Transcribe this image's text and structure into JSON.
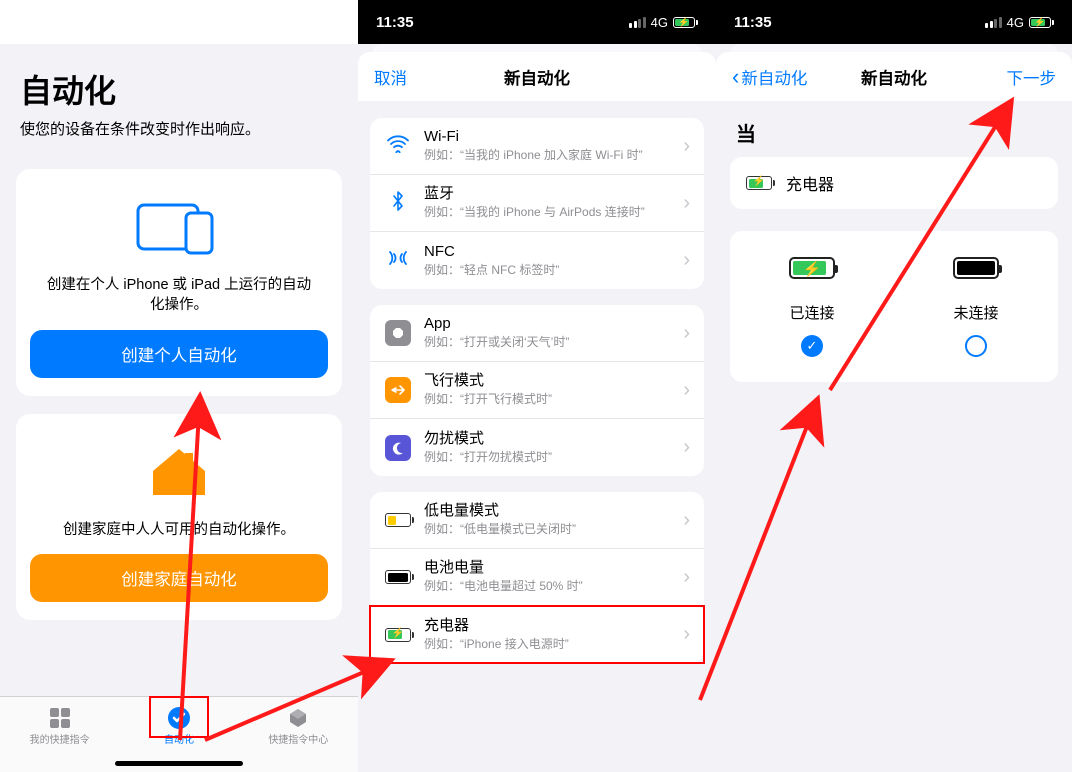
{
  "status": {
    "time": "11:35",
    "net": "4G"
  },
  "p1": {
    "title": "自动化",
    "subtitle": "使您的设备在条件改变时作出响应。",
    "card1_caption": "创建在个人 iPhone 或 iPad 上运行的自动化操作。",
    "card1_button": "创建个人自动化",
    "card2_caption": "创建家庭中人人可用的自动化操作。",
    "card2_button": "创建家庭自动化",
    "tabs": [
      "我的快捷指令",
      "自动化",
      "快捷指令中心"
    ]
  },
  "p2": {
    "cancel": "取消",
    "nav_title": "新自动化",
    "rows": [
      {
        "t1": "Wi-Fi",
        "t2": "例如：“当我的 iPhone 加入家庭 Wi-Fi 时”"
      },
      {
        "t1": "蓝牙",
        "t2": "例如：“当我的 iPhone 与 AirPods 连接时”"
      },
      {
        "t1": "NFC",
        "t2": "例如：“轻点 NFC 标签时”"
      },
      {
        "t1": "App",
        "t2": "例如：“打开或关闭‘天气’时”"
      },
      {
        "t1": "飞行模式",
        "t2": "例如：“打开飞行模式时”"
      },
      {
        "t1": "勿扰模式",
        "t2": "例如：“打开勿扰模式时”"
      },
      {
        "t1": "低电量模式",
        "t2": "例如：“低电量模式已关闭时”"
      },
      {
        "t1": "电池电量",
        "t2": "例如：“电池电量超过 50% 时”"
      },
      {
        "t1": "充电器",
        "t2": "例如：“iPhone 接入电源时”"
      }
    ]
  },
  "p3": {
    "back": "新自动化",
    "nav_title": "新自动化",
    "next": "下一步",
    "when": "当",
    "chip": "充电器",
    "opt_connected": "已连接",
    "opt_disconnected": "未连接"
  }
}
